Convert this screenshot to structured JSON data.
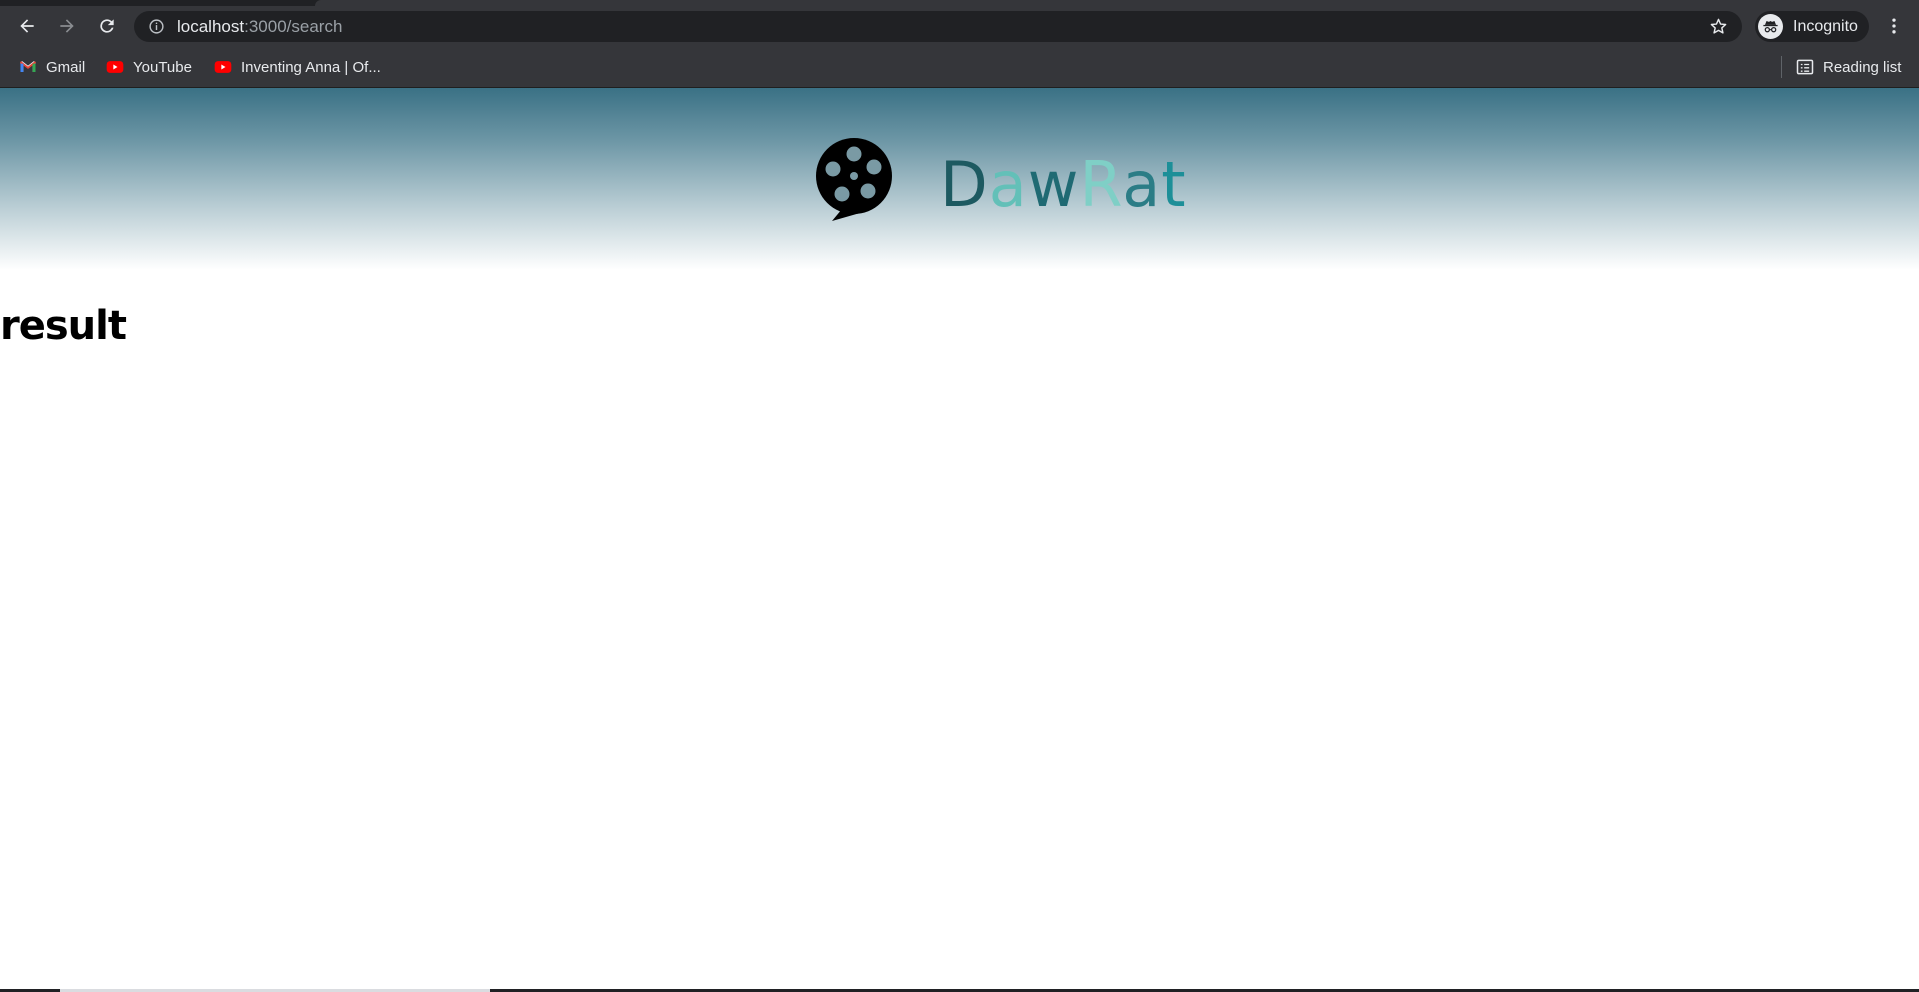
{
  "browser": {
    "url_host": "localhost",
    "url_path": ":3000/search",
    "profile_label": "Incognito",
    "bookmarks": [
      {
        "label": "Gmail",
        "icon": "gmail-icon"
      },
      {
        "label": "YouTube",
        "icon": "youtube-icon"
      },
      {
        "label": "Inventing Anna | Of...",
        "icon": "youtube-icon"
      }
    ],
    "reading_list_label": "Reading list"
  },
  "page": {
    "brand": {
      "parts": [
        "D",
        "a",
        "w",
        "R",
        "a",
        "t"
      ]
    },
    "heading": "result"
  },
  "colors": {
    "chrome_bg": "#35363a",
    "hero_top": "#3a7185",
    "brand_dark": "#1d5a61",
    "brand_light": "#63c0b8"
  }
}
